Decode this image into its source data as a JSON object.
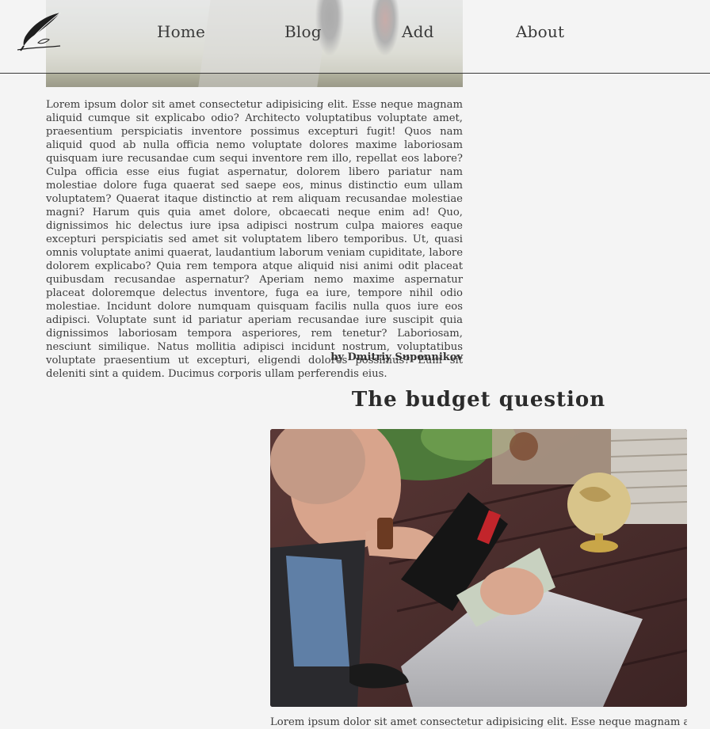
{
  "nav": {
    "home": "Home",
    "blog": "Blog",
    "add": "Add",
    "about": "About"
  },
  "post1": {
    "body": "Lorem ipsum dolor sit amet consectetur adipisicing elit. Esse neque magnam aliquid cumque sit explicabo odio? Architecto voluptatibus voluptate amet, praesentium perspiciatis inventore possimus excepturi fugit! Quos nam aliquid quod ab nulla officia nemo voluptate dolores maxime laboriosam quisquam iure recusandae cum sequi inventore rem illo, repellat eos labore? Culpa officia esse eius fugiat aspernatur, dolorem libero pariatur nam molestiae dolore fuga quaerat sed saepe eos, minus distinctio eum ullam voluptatem? Quaerat itaque distinctio at rem aliquam recusandae molestiae magni? Harum quis quia amet dolore, obcaecati neque enim ad! Quo, dignissimos hic delectus iure ipsa adipisci nostrum culpa maiores eaque excepturi perspiciatis sed amet sit voluptatem libero temporibus. Ut, quasi omnis voluptate animi quaerat, laudantium laborum veniam cupiditate, labore dolorem explicabo? Quia rem tempora atque aliquid nisi animi odit placeat quibusdam recusandae aspernatur? Aperiam nemo maxime aspernatur placeat doloremque delectus inventore, fuga ea iure, tempore nihil odio molestiae. Incidunt dolore numquam quisquam facilis nulla quos iure eos adipisci. Voluptate sunt id pariatur aperiam recusandae iure suscipit quia dignissimos laboriosam tempora asperiores, rem tenetur? Laboriosam, nesciunt similique. Natus mollitia adipisci incidunt nostrum, voluptatibus voluptate praesentium ut excepturi, eligendi dolores possimus? Eum sit deleniti sint a quidem. Ducimus corporis ullam perferendis eius.",
    "byline": "by Dmitriy Suponnikov"
  },
  "post2": {
    "title": "The budget question",
    "body": "Lorem ipsum dolor sit amet consectetur adipisicing elit. Esse neque magnam aliquid"
  },
  "colors": {
    "background": "#f4f4f4",
    "text": "#333333",
    "header_border": "#3a3a3a"
  },
  "icons": {
    "logo": "quill-feather-icon"
  }
}
